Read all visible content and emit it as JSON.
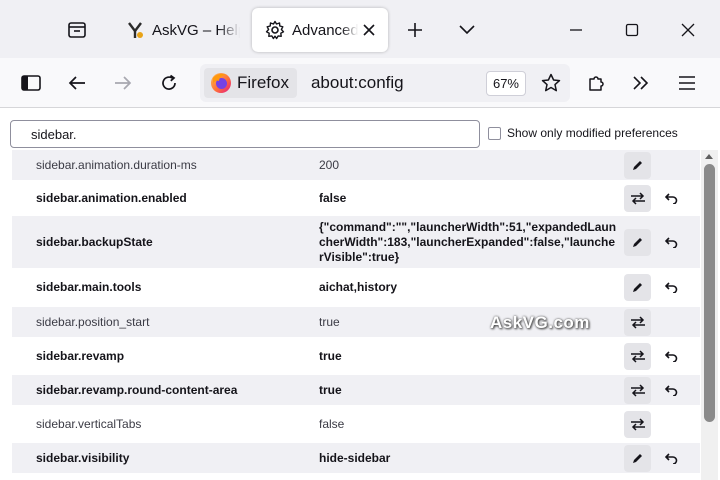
{
  "tabs": [
    {
      "title": "AskVG – Help",
      "favicon": "askvg-icon",
      "active": false
    },
    {
      "title": "Advanced Preferences",
      "favicon": "gear-icon",
      "active": true
    }
  ],
  "navbar": {
    "identity_label": "Firefox",
    "url": "about:config",
    "zoom": "67%"
  },
  "search": {
    "value": "sidebar."
  },
  "modified_toggle": {
    "label": "Show only modified preferences",
    "checked": false
  },
  "prefs": [
    {
      "name": "sidebar.animation.duration-ms",
      "value": "200",
      "modified": false,
      "action": "edit"
    },
    {
      "name": "sidebar.animation.enabled",
      "value": "false",
      "modified": true,
      "action": "toggle"
    },
    {
      "name": "sidebar.backupState",
      "value": "{\"command\":\"\",\"launcherWidth\":51,\"expandedLauncherWidth\":183,\"launcherExpanded\":false,\"launcherVisible\":true}",
      "modified": true,
      "action": "edit"
    },
    {
      "name": "sidebar.main.tools",
      "value": "aichat,history",
      "modified": true,
      "action": "edit"
    },
    {
      "name": "sidebar.position_start",
      "value": "true",
      "modified": false,
      "action": "toggle"
    },
    {
      "name": "sidebar.revamp",
      "value": "true",
      "modified": true,
      "action": "toggle"
    },
    {
      "name": "sidebar.revamp.round-content-area",
      "value": "true",
      "modified": true,
      "action": "toggle"
    },
    {
      "name": "sidebar.verticalTabs",
      "value": "false",
      "modified": false,
      "action": "toggle"
    },
    {
      "name": "sidebar.visibility",
      "value": "hide-sidebar",
      "modified": true,
      "action": "edit"
    }
  ],
  "watermark": "AskVG.com",
  "colors": {
    "firefox_orange": "#ff7139",
    "firefox_purple": "#7542e5",
    "active_tab": "#ffffff",
    "strip": "#f0f0f4"
  }
}
